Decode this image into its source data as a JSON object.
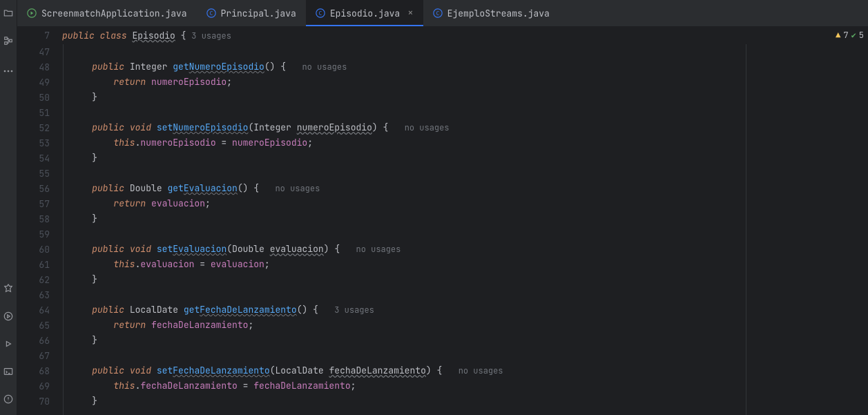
{
  "tabs": [
    {
      "label": "ScreenmatchApplication.java",
      "active": false,
      "kind": "run"
    },
    {
      "label": "Principal.java",
      "active": false,
      "kind": "class"
    },
    {
      "label": "Episodio.java",
      "active": true,
      "kind": "class"
    },
    {
      "label": "EjemploStreams.java",
      "active": false,
      "kind": "class"
    }
  ],
  "sticky": {
    "lineNo": "7",
    "kw_public": "public",
    "kw_class": "class",
    "classname": "Episodio",
    "brace": "{",
    "usages": "3 usages"
  },
  "status": {
    "warn_count": "7",
    "check_count": "5"
  },
  "gutter": [
    "47",
    "48",
    "49",
    "50",
    "51",
    "52",
    "53",
    "54",
    "55",
    "56",
    "57",
    "58",
    "59",
    "60",
    "61",
    "62",
    "63",
    "64",
    "65",
    "66",
    "67",
    "68",
    "69",
    "70"
  ],
  "code": {
    "l48": {
      "kw": "public",
      "type": "Integer",
      "get": "get",
      "name": "NumeroEpisodio",
      "after": "() {",
      "usages": "no usages"
    },
    "l49": {
      "ret": "return",
      "ident": "numeroEpisodio",
      "semi": ";"
    },
    "l50": {
      "brace": "}"
    },
    "l52": {
      "kw": "public",
      "ret": "void",
      "set": "set",
      "name": "NumeroEpisodio",
      "open": "(",
      "ptype": "Integer",
      "pname": "numeroEpisodio",
      "close": ") {",
      "usages": "no usages"
    },
    "l53": {
      "this": "this",
      "dot": ".",
      "field": "numeroEpisodio",
      "eq": " = ",
      "ident": "numeroEpisodio",
      "semi": ";"
    },
    "l54": {
      "brace": "}"
    },
    "l56": {
      "kw": "public",
      "type": "Double",
      "get": "get",
      "name": "Evaluacion",
      "after": "() {",
      "usages": "no usages"
    },
    "l57": {
      "ret": "return",
      "ident": "evaluacion",
      "semi": ";"
    },
    "l58": {
      "brace": "}"
    },
    "l60": {
      "kw": "public",
      "ret": "void",
      "set": "set",
      "name": "Evaluacion",
      "open": "(",
      "ptype": "Double",
      "pname": "evaluacion",
      "close": ") {",
      "usages": "no usages"
    },
    "l61": {
      "this": "this",
      "dot": ".",
      "field": "evaluacion",
      "eq": " = ",
      "ident": "evaluacion",
      "semi": ";"
    },
    "l62": {
      "brace": "}"
    },
    "l64": {
      "kw": "public",
      "type": "LocalDate",
      "get": "get",
      "name": "FechaDeLanzamiento",
      "after": "() {",
      "usages": "3 usages"
    },
    "l65": {
      "ret": "return",
      "ident": "fechaDeLanzamiento",
      "semi": ";"
    },
    "l66": {
      "brace": "}"
    },
    "l68": {
      "kw": "public",
      "ret": "void",
      "set": "set",
      "name": "FechaDeLanzamiento",
      "open": "(",
      "ptype": "LocalDate",
      "pname": "fechaDeLanzamiento",
      "close": ") {",
      "usages": "no usages"
    },
    "l69": {
      "this": "this",
      "dot": ".",
      "field": "fechaDeLanzamiento",
      "eq": " = ",
      "ident": "fechaDeLanzamiento",
      "semi": ";"
    },
    "l70": {
      "brace": "}"
    }
  }
}
